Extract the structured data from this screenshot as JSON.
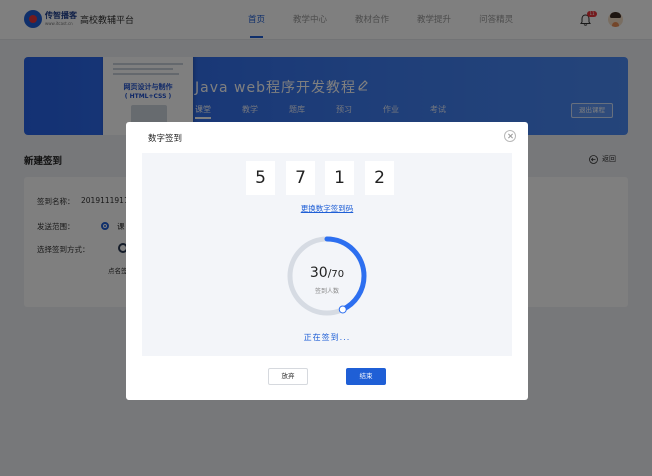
{
  "header": {
    "logo_name": "传智播客",
    "logo_url": "www.itcast.cn",
    "platform": "高校教辅平台",
    "nav": [
      "首页",
      "教学中心",
      "教材合作",
      "教学提升",
      "问答精灵"
    ],
    "notification_count": "11"
  },
  "banner": {
    "book_title": "网页设计与制作",
    "book_subtitle": "( HTML+CSS )",
    "course_title": "Java web程序开发教程",
    "tabs": [
      "课堂",
      "教学",
      "题库",
      "预习",
      "作业",
      "考试"
    ],
    "exit_label": "退出课程"
  },
  "page": {
    "section_title": "新建签到",
    "back_label": "返回"
  },
  "form": {
    "name_label": "签到名称：",
    "name_value": "2019111911",
    "range_label": "发送范围：",
    "range_value": "课",
    "method_label": "选择签到方式：",
    "method_option": "点名签"
  },
  "modal": {
    "title": "数字签到",
    "digits": [
      "5",
      "7",
      "1",
      "2"
    ],
    "refresh_label": "更换数字签到码",
    "checked_in": "30",
    "separator": "/",
    "total": "70",
    "count_label": "签到人数",
    "status": "正在签到...",
    "cancel_label": "放弃",
    "end_label": "结束",
    "progress_fraction": 0.43,
    "accent_color": "#1f5fd6"
  }
}
